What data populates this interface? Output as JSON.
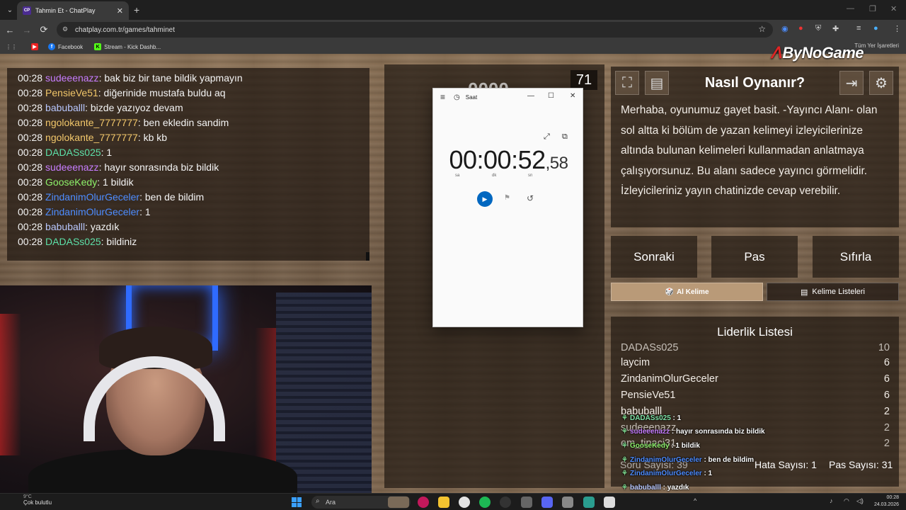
{
  "browser": {
    "tab_title": "Tahmin Et - ChatPlay",
    "tab_favicon": "CP",
    "new_tab": "+",
    "close_tab": "✕",
    "url": "chatplay.com.tr/games/tahminet",
    "bookmarks": [
      {
        "label": "",
        "icon": "youtube-icon"
      },
      {
        "label": "Facebook",
        "icon": "facebook-icon"
      },
      {
        "label": "Stream - Kick Dashb...",
        "icon": "kick-icon"
      }
    ],
    "all_bookmarks": "Tüm Yer İşaretleri"
  },
  "brand": {
    "name": "ByNoGame"
  },
  "chat": {
    "messages": [
      {
        "time": "00:28",
        "user": "sudeeenazz",
        "text": ": bak biz bir tane bildik yapmayın",
        "color": "#c77dff"
      },
      {
        "time": "00:28",
        "user": "PensieVe51",
        "text": ": diğerinide mustafa buldu aq",
        "color": "#f3c86b"
      },
      {
        "time": "00:28",
        "user": "babuballl",
        "text": ": bizde yazıyoz devam",
        "color": "#b9c8ff"
      },
      {
        "time": "00:28",
        "user": "ngolokante_7777777",
        "text": ": ben ekledin sandim",
        "color": "#f3c86b"
      },
      {
        "time": "00:28",
        "user": "ngolokante_7777777",
        "text": ": kb kb",
        "color": "#f3c86b"
      },
      {
        "time": "00:28",
        "user": "DADASs025",
        "text": ": 1",
        "color": "#5de0a8"
      },
      {
        "time": "00:28",
        "user": "sudeeenazz",
        "text": ": hayır sonrasında biz bildik",
        "color": "#c77dff"
      },
      {
        "time": "00:28",
        "user": "GooseKedy",
        "text": ": 1 bildik",
        "color": "#8df06a"
      },
      {
        "time": "00:28",
        "user": "ZindanimOlurGeceler",
        "text": ": ben de bildim",
        "color": "#4d8cff"
      },
      {
        "time": "00:28",
        "user": "ZindanimOlurGeceler",
        "text": ": 1",
        "color": "#4d8cff"
      },
      {
        "time": "00:28",
        "user": "babuballl",
        "text": ": yazdık",
        "color": "#b9c8ff"
      },
      {
        "time": "00:28",
        "user": "DADASs025",
        "text": ": bildiniz",
        "color": "#5de0a8"
      }
    ]
  },
  "game": {
    "counter": "71",
    "ghost_text": "0000"
  },
  "clock_app": {
    "title": "Saat",
    "time_main": "00:00:52",
    "time_ms": ",58",
    "units": [
      "sa",
      "dk",
      "sn"
    ],
    "minimize": "—",
    "maximize": "☐",
    "close": "✕"
  },
  "howto": {
    "title": "Nasıl Oynanır?",
    "text": "Merhaba, oyunumuz gayet basit. -Yayıncı Alanı- olan sol altta ki bölüm de yazan kelimeyi izleyicilerinize altında bulunan kelimeleri kullanmadan anlatmaya çalışıyorsunuz. Bu alanı sadece yayıncı görmelidir. İzleyicileriniz yayın chatinizde cevap verebilir."
  },
  "buttons": {
    "next": "Sonraki",
    "pass": "Pas",
    "reset": "Sıfırla",
    "get_word": "Al Kelime",
    "word_lists": "Kelime Listeleri"
  },
  "leaderboard": {
    "title": "Liderlik Listesi",
    "rows": [
      {
        "name": "DADASs025",
        "score": "10"
      },
      {
        "name": "laycim",
        "score": "6"
      },
      {
        "name": "ZindanimOlurGeceler",
        "score": "6"
      },
      {
        "name": "PensieVe51",
        "score": "6"
      },
      {
        "name": "babuballl",
        "score": "2"
      },
      {
        "name": "sudeeenazz",
        "score": "2"
      },
      {
        "name": "em_tipaci31",
        "score": "2"
      }
    ]
  },
  "stats": {
    "questions": "Soru Sayısı: 39",
    "errors": "Hata Sayısı: 1",
    "passes": "Pas Sayısı: 31"
  },
  "overlay_chat": [
    {
      "user": "DADASs025",
      "text": " : 1",
      "color": "#7de3a7"
    },
    {
      "user": "sudeeenazz",
      "text": " : hayır sonrasında biz bildik",
      "color": "#c77dff"
    },
    {
      "user": "GooseKedy",
      "text": " : 1 bildik",
      "color": "#8df06a"
    },
    {
      "user": "ZindanimOlurGeceler",
      "text": " : ben de bildim",
      "color": "#4d8cff"
    },
    {
      "user": "ZindanimOlurGeceler",
      "text": " : 1",
      "color": "#4d8cff"
    },
    {
      "user": "babuballl",
      "text": " : yazdık",
      "color": "#b9c8ff"
    }
  ],
  "taskbar": {
    "weather": "Çok bulutlu",
    "weather_deg": "9°C",
    "search": "Ara",
    "time": "00:28",
    "date": "24.03.2026"
  }
}
